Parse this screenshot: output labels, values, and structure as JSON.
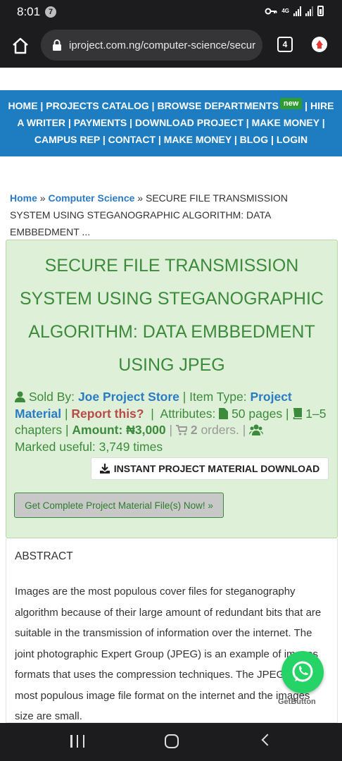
{
  "status_bar": {
    "time": "8:01",
    "notif_count": "7",
    "network": "4G"
  },
  "browser": {
    "url": "iproject.com.ng/computer-science/secur",
    "tab_count": "4"
  },
  "nav": {
    "home": "HOME",
    "catalog": "PROJECTS CATALOG",
    "browse": "BROWSE DEPARTMENTS",
    "new_badge": "new",
    "hire": "HIRE",
    "writer": "A WRITER",
    "payments": "PAYMENTS",
    "download": "DOWNLOAD PROJECT",
    "make_money": "MAKE MONEY",
    "campus_rep": "CAMPUS REP",
    "contact": "CONTACT",
    "make_money2": "MAKE MONEY",
    "blog": "BLOG",
    "login": "LOGIN"
  },
  "breadcrumb": {
    "home": "Home",
    "category": "Computer Science",
    "current": "SECURE FILE TRANSMISSION SYSTEM USING STEGANOGRAPHIC ALGORITHM: DATA EMBBEDMENT ..."
  },
  "product": {
    "title": "SECURE FILE TRANSMISSION SYSTEM USING STEGANOGRAPHIC ALGORITHM: DATA EMBBEDMENT USING JPEG",
    "sold_by_label": "Sold By:",
    "seller": "Joe Project Store",
    "item_type_label": "Item Type:",
    "item_type": "Project Material",
    "report": "Report this?",
    "attributes_label": "Attributes:",
    "pages": "50 pages",
    "chapters": "1–5 chapters",
    "amount_label": "Amount:",
    "amount": "₦3,000",
    "orders_count": "2",
    "orders_label": "orders.",
    "marked_useful": "Marked useful: 3,749 times",
    "download_button": "INSTANT PROJECT MATERIAL DOWNLOAD",
    "complete_button": "Get Complete Project Material File(s) Now! »"
  },
  "abstract": {
    "heading": "ABSTRACT",
    "body": "Images are the most populous cover files for steganography algorithm because of their large amount of redundant bits that are suitable in the transmission of information over the internet. The joint photographic Expert Group (JPEG) is an example of images formats that uses the compression techniques. The JPEG is the most populous image file format on the internet and the images size are small."
  },
  "widget": {
    "getbutton_label": "GetButton"
  },
  "colors": {
    "nav_blue": "#1e7dc1",
    "panel_green": "#dff0d8",
    "text_green": "#3c8a3c",
    "link_blue": "#2a7bc4",
    "report_red": "#b94a48",
    "whatsapp": "#25d366"
  }
}
